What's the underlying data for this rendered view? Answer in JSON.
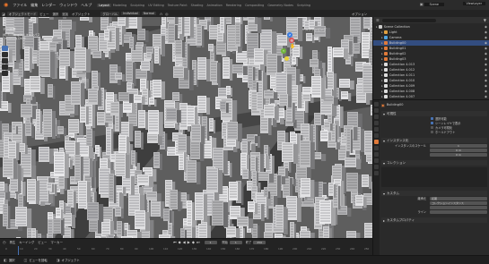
{
  "titlebar": {
    "menus": [
      "ファイル",
      "編集",
      "レンダー",
      "ウィンドウ",
      "ヘルプ"
    ],
    "tabs": [
      "Layout",
      "Modeling",
      "Sculpting",
      "UV Editing",
      "Texture Paint",
      "Shading",
      "Animation",
      "Rendering",
      "Compositing",
      "Geometry Nodes",
      "Scripting"
    ],
    "active_tab": "Layout",
    "scene_label": "Scene",
    "viewlayer_label": "ViewLayer"
  },
  "viewport_header": {
    "mode": "オブジェクトモード",
    "menus": [
      "ビュー",
      "選択",
      "追加",
      "オブジェクト"
    ],
    "transform": "グローバル",
    "pivot": "Individual",
    "snap": "Normal",
    "options_label": "オプション"
  },
  "viewport_overlay": {
    "view_name": "テラ座標",
    "info1": "(6) Building00 | キャンバス",
    "info2": "Rendering Done",
    "gizmo_axes": [
      "X",
      "Y",
      "Z"
    ],
    "navi_label": "スクラッピング"
  },
  "outliner": {
    "search_placeholder": "",
    "rows": [
      {
        "label": "Scene Collection",
        "indent": 0,
        "color": "#cccccc"
      },
      {
        "label": "Light",
        "indent": 1,
        "color": "#e0a040"
      },
      {
        "label": "Camera",
        "indent": 1,
        "color": "#4fa3e0"
      },
      {
        "label": "Building00",
        "indent": 1,
        "color": "#e07a3a"
      },
      {
        "label": "Building01",
        "indent": 1,
        "color": "#e07a3a"
      },
      {
        "label": "Building02",
        "indent": 1,
        "color": "#e07a3a"
      },
      {
        "label": "Building03",
        "indent": 1,
        "color": "#e07a3a"
      },
      {
        "label": "Collection 4.013",
        "indent": 1,
        "color": "#dddddd"
      },
      {
        "label": "Collection 4.012",
        "indent": 1,
        "color": "#dddddd"
      },
      {
        "label": "Collection 4.011",
        "indent": 1,
        "color": "#dddddd"
      },
      {
        "label": "Collection 4.010",
        "indent": 1,
        "color": "#dddddd"
      },
      {
        "label": "Collection 4.009",
        "indent": 1,
        "color": "#dddddd"
      },
      {
        "label": "Collection 4.008",
        "indent": 1,
        "color": "#dddddd"
      },
      {
        "label": "Collection 4.007",
        "indent": 1,
        "color": "#dddddd"
      },
      {
        "label": "Collection 4.006",
        "indent": 1,
        "color": "#dddddd"
      }
    ]
  },
  "properties": {
    "object_name": "Building00",
    "section_visibility": "可視性",
    "checks": [
      "選択可能",
      "シーンレイヤで表示",
      "カメラ可視化",
      "ホールドアウト"
    ],
    "section_instancing": "インスタンス化",
    "instancing_rows": [
      {
        "label": "インスタンスのスケール",
        "value": "1"
      },
      {
        "label": "",
        "value": "0 m"
      },
      {
        "label": "",
        "value": "0 m"
      }
    ],
    "section_collection": "コレクション",
    "section_custom": "カスタム",
    "custom_rows": [
      {
        "label": "継承元",
        "value": "初期"
      },
      {
        "label": "",
        "value": "コレクションインスタンス"
      },
      {
        "label": "",
        "value": ""
      },
      {
        "label": "ライン",
        "value": ""
      }
    ],
    "section_last": "カスタムプロパティ"
  },
  "timeline": {
    "menus": [
      "再生",
      "キーイング",
      "ビュー",
      "マーカー"
    ],
    "frame_current": "1",
    "start_label": "開始",
    "start": "1",
    "end_label": "終了",
    "end": "250",
    "ticks": [
      "0",
      "10",
      "20",
      "30",
      "40",
      "50",
      "60",
      "70",
      "80",
      "90",
      "100",
      "110",
      "120",
      "130",
      "140",
      "150",
      "160",
      "170",
      "180",
      "190",
      "200",
      "210",
      "220",
      "230",
      "240",
      "250"
    ]
  },
  "status": {
    "left": "選択",
    "middle": "ビューを回転",
    "right": "オブジェクト"
  },
  "colors": {
    "accent": "#4772b3",
    "active_object": "#e07a3a",
    "playhead": "#4772b3"
  }
}
